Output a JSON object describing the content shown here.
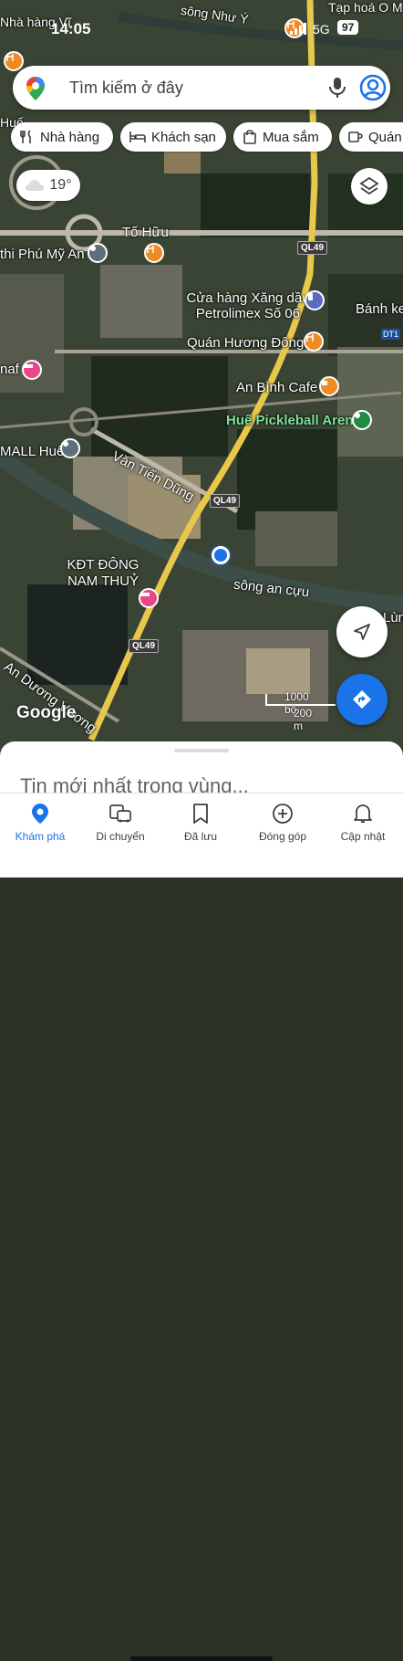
{
  "status": {
    "time": "14:05",
    "network": "5G",
    "battery": "97"
  },
  "search": {
    "placeholder": "Tìm kiếm ở đây"
  },
  "chips": [
    "Nhà hàng",
    "Khách sạn",
    "Mua sắm",
    "Quán"
  ],
  "weather": {
    "temp": "19°"
  },
  "map_labels": {
    "top_left": "Nhà hàng Vĩ",
    "top_river": "sông Như Ý",
    "top_right": "Tạp hoá O M",
    "hue_top": "Huế",
    "to_huu": "Tố Hữu",
    "phu_my_an": "thi Phú Mỹ An",
    "petrol": "Cửa hàng Xăng dầu Petrolimex Số 06",
    "banh_ken": "Bánh ken",
    "huong_dong": "Quán Hương Đông",
    "an_binh": "An Bình Cafe",
    "pickleball": "Huế Pickleball Arena",
    "naf": "naf",
    "mall": "MALL Huế",
    "van_tien_dung": "Văn Tiến Dũng",
    "kdt": "KĐT ĐÔNG NAM THUỶ",
    "song_an_cuu": "sông an cựu",
    "an_duong_vuong": "An Dương Vương",
    "lum": "Lùn",
    "ql49": "QL49",
    "dt1": "DT1"
  },
  "attribution": "Google",
  "scale": {
    "imperial": "1000 bộ",
    "metric": "200 m"
  },
  "sheet": {
    "title": "Tin mới nhất trong vùng..."
  },
  "nav": [
    {
      "label": "Khám phá",
      "icon": "explore-pin-icon",
      "active": true
    },
    {
      "label": "Di chuyển",
      "icon": "commute-icon",
      "active": false
    },
    {
      "label": "Đã lưu",
      "icon": "bookmark-icon",
      "active": false
    },
    {
      "label": "Đóng góp",
      "icon": "add-circle-icon",
      "active": false
    },
    {
      "label": "Cập nhật",
      "icon": "bell-icon",
      "active": false
    }
  ],
  "colors": {
    "accent": "#1a73e8",
    "road": "#e8c84a",
    "water": "#3d4d48"
  }
}
